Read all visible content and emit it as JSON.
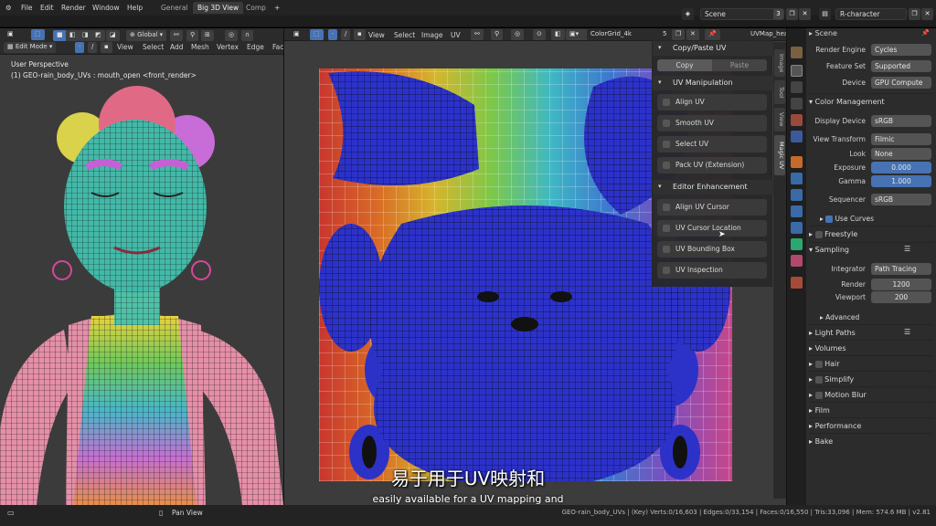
{
  "menubar": {
    "items": [
      "File",
      "Edit",
      "Render",
      "Window",
      "Help"
    ],
    "workspace_tabs": [
      {
        "label": "General",
        "active": false
      },
      {
        "label": "Big 3D View",
        "active": true
      },
      {
        "label": "Comp",
        "active": false
      }
    ],
    "add_tab": "+",
    "scene_name": "Scene",
    "scene_count": "3",
    "view_layer": "R-character"
  },
  "left_view": {
    "mode": "Edit Mode",
    "orientation": "Global",
    "menus": [
      "View",
      "Select",
      "Add",
      "Mesh",
      "Vertex",
      "Edge",
      "Fac"
    ],
    "perspective_label": "User Perspective",
    "object_label": "(1) GEO-rain_body_UVs : mouth_open <front_render>"
  },
  "uv_editor": {
    "menus": [
      "View",
      "Select",
      "Image",
      "UV"
    ],
    "image_name": "ColorGrid_4k",
    "image_users": "5",
    "uv_map": "UVMap_hea",
    "sidebar_tabs": [
      "Image",
      "Tool",
      "View",
      "Magic UV"
    ],
    "copy_paste_title": "Copy/Paste UV",
    "copy_label": "Copy",
    "paste_label": "Paste",
    "uv_manipulation_title": "UV Manipulation",
    "manipulation_items": [
      "Align UV",
      "Smooth UV",
      "Select UV",
      "Pack UV (Extension)"
    ],
    "editor_enhancement_title": "Editor Enhancement",
    "enhancement_items": [
      "Align UV Cursor",
      "UV Cursor Location",
      "UV Bounding Box",
      "UV Inspection"
    ]
  },
  "properties": {
    "scene_title": "Scene",
    "render_engine_label": "Render Engine",
    "render_engine": "Cycles",
    "feature_set_label": "Feature Set",
    "feature_set": "Supported",
    "device_label": "Device",
    "device": "GPU Compute",
    "color_management": "Color Management",
    "display_device_label": "Display Device",
    "display_device": "sRGB",
    "view_transform_label": "View Transform",
    "view_transform": "Filmic",
    "look_label": "Look",
    "look": "None",
    "exposure_label": "Exposure",
    "exposure": "0.000",
    "gamma_label": "Gamma",
    "gamma": "1.000",
    "sequencer_label": "Sequencer",
    "sequencer": "sRGB",
    "use_curves": "Use Curves",
    "freestyle": "Freestyle",
    "sampling": "Sampling",
    "integrator_label": "Integrator",
    "integrator": "Path Tracing",
    "render_label": "Render",
    "render_samples": "1200",
    "viewport_label": "Viewport",
    "viewport_samples": "200",
    "advanced": "Advanced",
    "sections": [
      "Light Paths",
      "Volumes",
      "Hair",
      "Simplify",
      "Motion Blur",
      "Film",
      "Performance",
      "Bake"
    ]
  },
  "statusbar": {
    "pan_view": "Pan View",
    "stats": "GEO-rain_body_UVs | (Key) Verts:0/16,603 | Edges:0/33,154 | Faces:0/16,550 | Tris:33,096 | Mem: 574.6 MB | v2.81"
  },
  "subtitles": {
    "chinese": "易于用于UV映射和",
    "english": "easily available for a UV mapping and"
  },
  "colors": {
    "accent_blue": "#4772b3",
    "uv_island_blue": "#2c32c8",
    "body_pink": "#e58fa8"
  }
}
